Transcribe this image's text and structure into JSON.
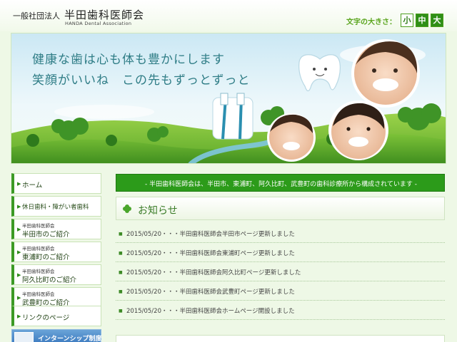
{
  "header": {
    "org_prefix": "一般社団法人",
    "org_name": "半田歯科医師会",
    "org_name_en": "HANDA Dental Association",
    "font_size_label": "文字の大きさ：",
    "font_sizes": [
      "小",
      "中",
      "大"
    ]
  },
  "banner": {
    "line1": "健康な歯は心も体も豊かにします",
    "line2": "笑顔がいいね　この先もずっとずっと"
  },
  "sidebar": {
    "items": [
      {
        "main": "ホーム"
      },
      {
        "main": "休日歯科・障がい者歯科"
      },
      {
        "sub": "半田歯科医師会",
        "main": "半田市のご紹介"
      },
      {
        "sub": "半田歯科医師会",
        "main": "東浦町のご紹介"
      },
      {
        "sub": "半田歯科医師会",
        "main": "阿久比町のご紹介"
      },
      {
        "sub": "半田歯科医師会",
        "main": "武豊町のご紹介"
      },
      {
        "main": "リンクのページ"
      }
    ],
    "intern_label": "インターンシップ制度"
  },
  "notice": {
    "text": "- 半田歯科医師会は、半田市、東浦町、阿久比町、武豊町の歯科診療所から構成されています -"
  },
  "news": {
    "title": "お知らせ",
    "items": [
      "2015/05/20・・・半田歯科医師会半田市ページ更新しました",
      "2015/05/20・・・半田歯科医師会東浦町ページ更新しました",
      "2015/05/20・・・半田歯科医師会阿久比町ページ更新しました",
      "2015/05/20・・・半田歯科医師会武豊町ページ更新しました",
      "2015/05/20・・・半田歯科医師会ホームページ開設しました"
    ]
  },
  "colors": {
    "accent_green": "#2c9b1a",
    "banner_text": "#2f7d86",
    "page_bg": "#eef8e6"
  }
}
